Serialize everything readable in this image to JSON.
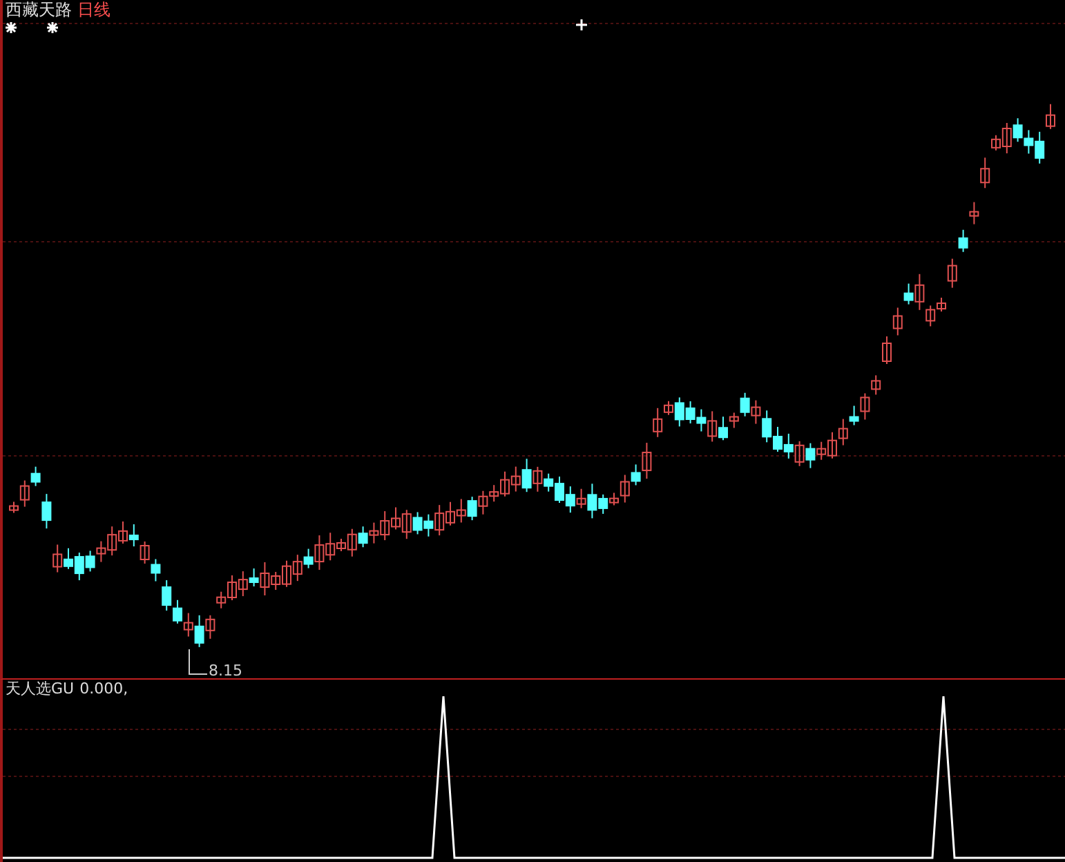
{
  "main_chart": {
    "title": "西藏天路",
    "period": "日线",
    "low_label": "8.15"
  },
  "indicator_panel": {
    "name": "天人选GU",
    "value": "0.000,"
  }
}
